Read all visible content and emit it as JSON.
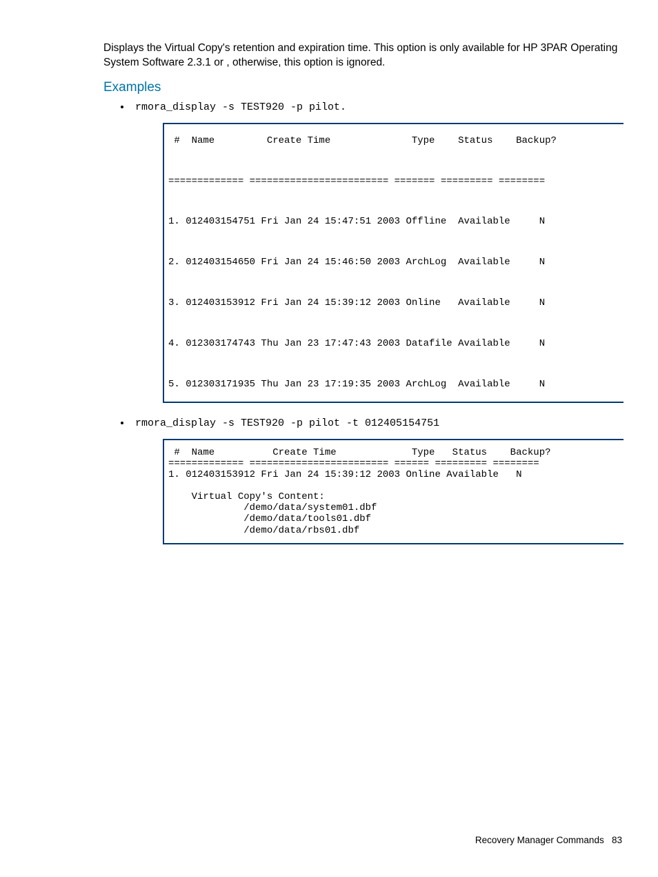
{
  "intro": "Displays the Virtual Copy's retention and expiration time. This option is only available for HP 3PAR Operating System Software 2.3.1 or , otherwise, this option is ignored.",
  "heading": "Examples",
  "examples": [
    {
      "command": "rmora_display -s TEST920 -p pilot.",
      "output": " #  Name         Create Time              Type    Status    Backup?\n\n============= ======================== ======= ========= ========\n\n1. 012403154751 Fri Jan 24 15:47:51 2003 Offline  Available     N\n\n2. 012403154650 Fri Jan 24 15:46:50 2003 ArchLog  Available     N\n\n3. 012403153912 Fri Jan 24 15:39:12 2003 Online   Available     N\n\n4. 012303174743 Thu Jan 23 17:47:43 2003 Datafile Available     N\n\n5. 012303171935 Thu Jan 23 17:19:35 2003 ArchLog  Available     N"
    },
    {
      "command": "rmora_display -s TEST920 -p pilot -t 012405154751",
      "output": " #  Name          Create Time             Type   Status    Backup?\n============= ======================== ====== ========= ========\n1. 012403153912 Fri Jan 24 15:39:12 2003 Online Available   N\n\n    Virtual Copy's Content:\n             /demo/data/system01.dbf\n             /demo/data/tools01.dbf\n             /demo/data/rbs01.dbf"
    }
  ],
  "footer": {
    "section": "Recovery Manager Commands",
    "page": "83"
  }
}
